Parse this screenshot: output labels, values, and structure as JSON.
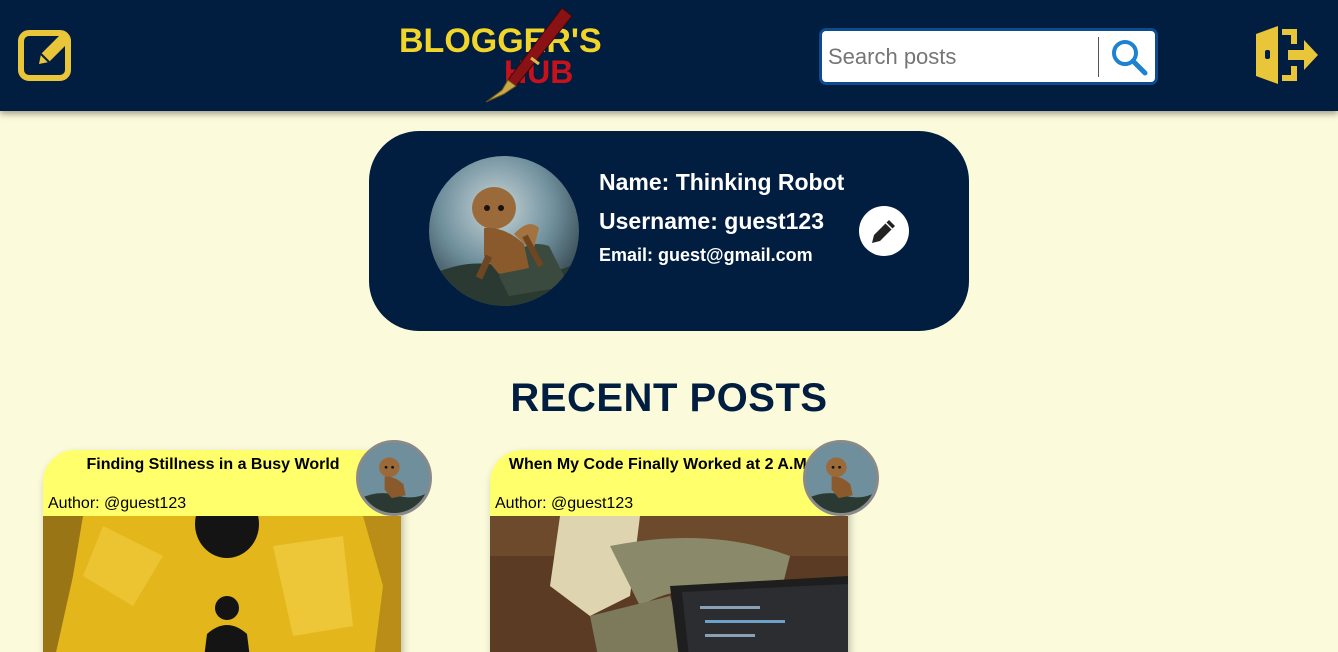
{
  "navbar": {
    "logo_line1": "BLOGGER'S",
    "logo_line2": "HUB",
    "search_placeholder": "Search posts",
    "search_value": "",
    "icons": {
      "new_post": "edit-square-icon",
      "search": "search-icon",
      "logout": "logout-icon"
    }
  },
  "profile": {
    "name": "Name: Thinking Robot",
    "username": "Username: guest123",
    "email": "Email: guest@gmail.com",
    "edit_icon": "pencil-icon"
  },
  "recent_posts": {
    "heading": "RECENT POSTS",
    "posts": [
      {
        "title": "Finding Stillness in a Busy World",
        "author": "Author: @guest123"
      },
      {
        "title": "When My Code Finally Worked at 2 A.M.",
        "author": "Author: @guest123"
      }
    ]
  },
  "colors": {
    "page_bg": "#fbfadb",
    "navy": "#011d3f",
    "accent_yellow": "#e9c53a",
    "post_header": "#ffff6b"
  }
}
